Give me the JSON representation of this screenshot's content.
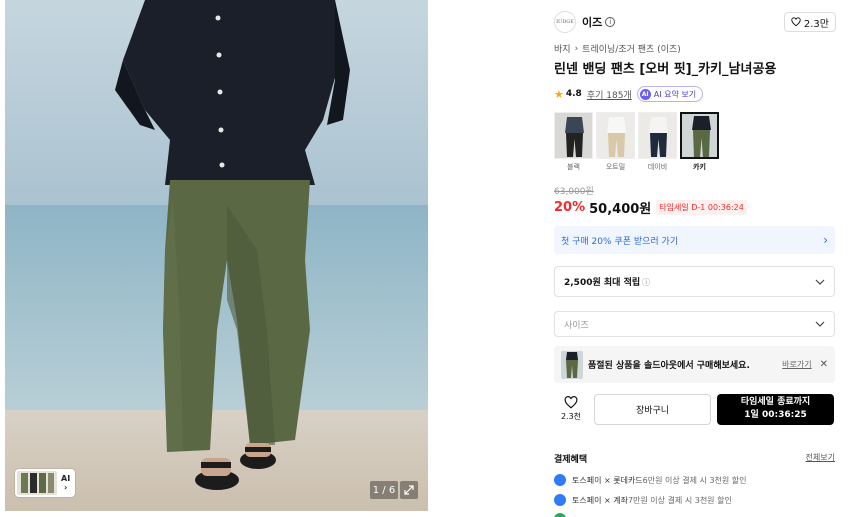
{
  "gallery": {
    "counter": "1 / 6",
    "ai_thumb_label": "AI",
    "ai_thumb_chevron": "›",
    "expand_icon": "expand-icon"
  },
  "brand": {
    "logo_text": "IUDGE",
    "name": "이즈",
    "like_count": "2.3만"
  },
  "breadcrumb": [
    "바지",
    "트레이닝/조거 팬츠 (이즈)"
  ],
  "product": {
    "title": "린넨 밴딩 팬츠 [오버 핏]_카키_남녀공용",
    "rating": "4.8",
    "review_text": "후기 185개",
    "ai_summary": "AI 요약 보기"
  },
  "colors": [
    {
      "label": "블랙",
      "selected": false
    },
    {
      "label": "오트밀",
      "selected": false
    },
    {
      "label": "데이비",
      "selected": false
    },
    {
      "label": "카키",
      "selected": true
    }
  ],
  "pricing": {
    "original": "63,000원",
    "discount": "20%",
    "price": "50,400원",
    "timer_badge": "타임세일 D-1 00:36:24"
  },
  "coupon": {
    "text": "첫 구매 20% 쿠폰 받으러 가기"
  },
  "points": {
    "text": "2,500원 최대 적립",
    "hint": "ⓘ"
  },
  "size_select": {
    "placeholder": "사이즈"
  },
  "soldout": {
    "message": "품절된 상품을 솔드아웃에서 구매해보세요.",
    "link": "바로가기",
    "close": "✕"
  },
  "actions": {
    "wish_count": "2.3천",
    "cart_label": "장바구니",
    "buy_line1": "타임세일 종료까지",
    "buy_line2": "1일 00:36:25"
  },
  "benefits": {
    "heading": "결제혜택",
    "more": "전체보기",
    "items": [
      {
        "prefix": "토스페이 × 롯데카드",
        "suffix": " 6만원 이상 결제 시 3천원 할인"
      },
      {
        "prefix": "토스페이 × 계좌",
        "suffix": " 7만원 이상 결제 시 3천원 할인"
      }
    ]
  },
  "colors_theme": {
    "accent_red": "#ef2b2b",
    "coupon_blue": "#2b6ad8",
    "ai_purple": "#6b5cf0",
    "buy_black": "#000000"
  }
}
